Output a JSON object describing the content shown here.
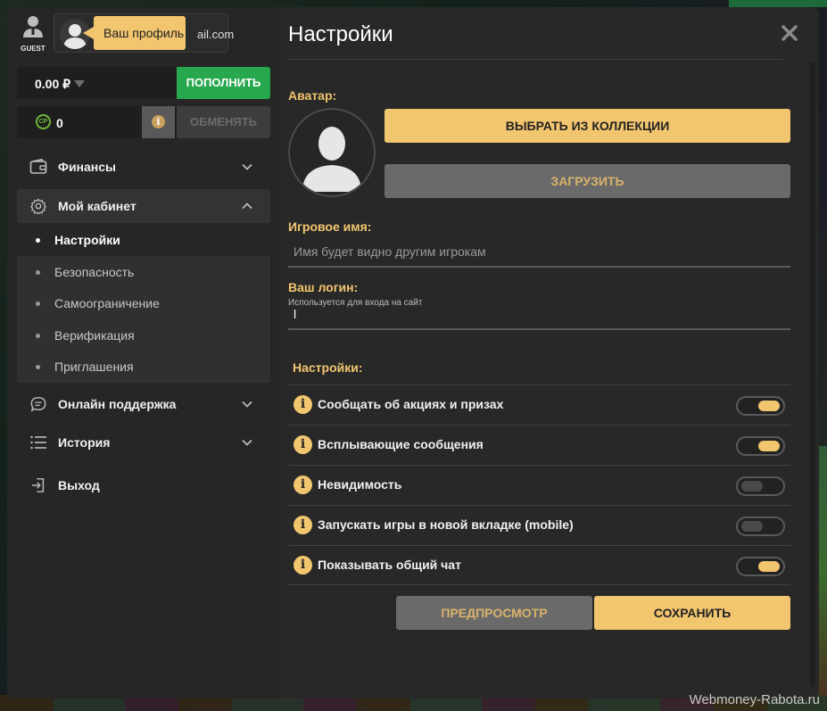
{
  "sidebar": {
    "guest_label": "GUEST",
    "profile_email": "ail.com",
    "tooltip": "Ваш профиль",
    "balance": "0.00 ₽",
    "topup_label": "ПОПОЛНИТЬ",
    "cp_badge": "CP",
    "cp_value": "0",
    "info_glyph": "i",
    "exchange_label": "ОБМЕНЯТЬ",
    "nav": {
      "finance": "Финансы",
      "cabinet": "Мой кабинет",
      "support": "Онлайн поддержка",
      "history": "История",
      "logout": "Выход"
    },
    "submenu": [
      "Настройки",
      "Безопасность",
      "Самоограничение",
      "Верификация",
      "Приглашения"
    ]
  },
  "main": {
    "title": "Настройки",
    "avatar_label": "Аватар:",
    "choose_label": "ВЫБРАТЬ ИЗ КОЛЛЕКЦИИ",
    "upload_label": "ЗАГРУЗИТЬ",
    "gamename_label": "Игровое имя:",
    "gamename_placeholder": "Имя будет видно другим игрокам",
    "login_label": "Ваш логин:",
    "login_hint": "Используется для входа на сайт",
    "login_value": "l",
    "settings_label": "Настройки:",
    "toggles": [
      {
        "label": "Сообщать об акциях и призах",
        "on": true
      },
      {
        "label": "Всплывающие сообщения",
        "on": true
      },
      {
        "label": "Невидимость",
        "on": false
      },
      {
        "label": "Запускать игры в новой вкладке (mobile)",
        "on": false
      },
      {
        "label": "Показывать общий чат",
        "on": true
      }
    ],
    "preview_label": "ПРЕДПРОСМОТР",
    "save_label": "СОХРАНИТЬ"
  },
  "watermark": "Webmoney-Rabota.ru",
  "colors": {
    "accent_gold": "#f2c56f",
    "topup_green": "#28a84e",
    "panel_bg": "#262626"
  }
}
